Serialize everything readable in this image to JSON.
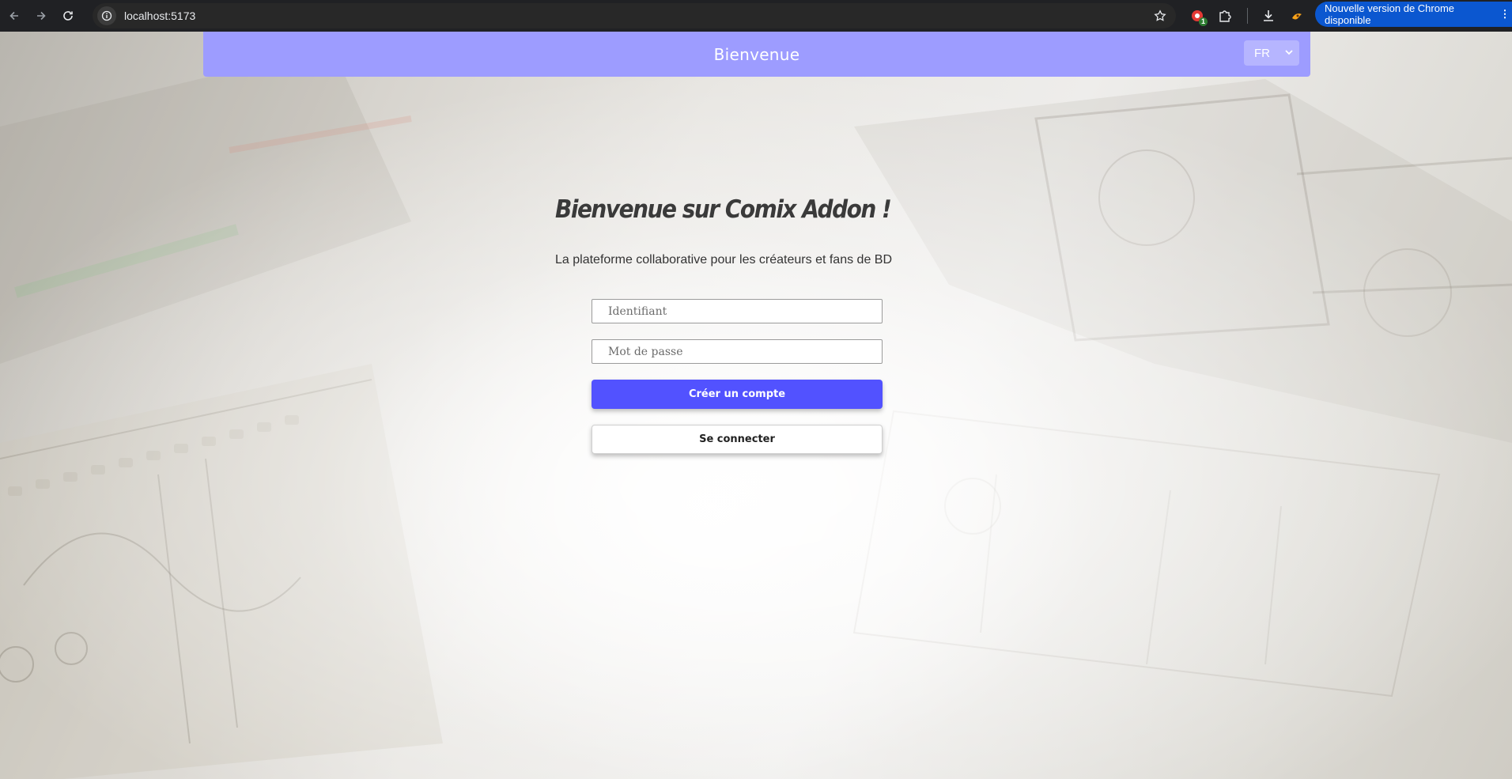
{
  "browser": {
    "url": "localhost:5173",
    "update_banner": "Nouvelle version de Chrome disponible",
    "extension_badge": "1"
  },
  "header": {
    "title": "Bienvenue",
    "language": "FR"
  },
  "main": {
    "title": "Bienvenue sur Comix Addon !",
    "subtitle": "La plateforme collaborative pour les créateurs et fans de BD",
    "username_placeholder": "Identifiant",
    "password_placeholder": "Mot de passe",
    "create_account_label": "Créer un compte",
    "login_label": "Se connecter"
  },
  "colors": {
    "header_bg": "#9d9cff",
    "primary_button": "#5252ff",
    "chrome_bg": "#202124",
    "update_pill": "#0b57d0"
  }
}
